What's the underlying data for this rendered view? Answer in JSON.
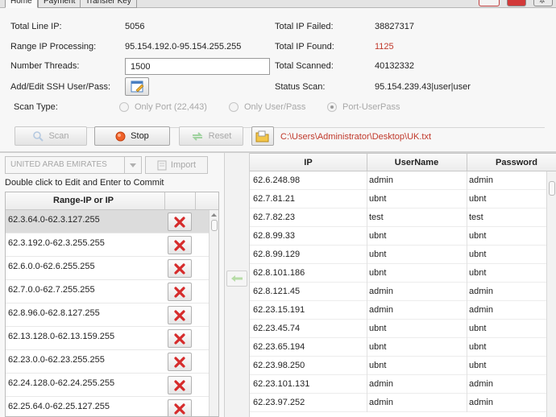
{
  "tabs": [
    "Home",
    "Payment",
    "Transfer Key"
  ],
  "stats": {
    "total_line_ip_label": "Total Line IP:",
    "total_line_ip": "5056",
    "range_ip_label": "Range IP Processing:",
    "range_ip": "95.154.192.0-95.154.255.255",
    "threads_label": "Number Threads:",
    "threads_value": "1500",
    "ssh_label": "Add/Edit SSH User/Pass:",
    "total_failed_label": "Total IP Failed:",
    "total_failed": "38827317",
    "total_found_label": "Total IP Found:",
    "total_found": "1125",
    "total_scanned_label": "Total Scanned:",
    "total_scanned": "40132332",
    "status_label": "Status Scan:",
    "status": "95.154.239.43|user|user"
  },
  "scan_type": {
    "label": "Scan Type:",
    "options": [
      "Only Port (22,443)",
      "Only User/Pass",
      "Port-UserPass"
    ],
    "selected": "Port-UserPass"
  },
  "toolbar": {
    "scan": "Scan",
    "stop": "Stop",
    "reset": "Reset",
    "path": "C:\\Users\\Administrator\\Desktop\\UK.txt"
  },
  "left": {
    "country": "UNITED ARAB EMIRATES",
    "import": "Import",
    "hint": "Double click to Edit and Enter to Commit",
    "column": "Range-IP or IP",
    "ranges": [
      "62.3.64.0-62.3.127.255",
      "62.3.192.0-62.3.255.255",
      "62.6.0.0-62.6.255.255",
      "62.7.0.0-62.7.255.255",
      "62.8.96.0-62.8.127.255",
      "62.13.128.0-62.13.159.255",
      "62.23.0.0-62.23.255.255",
      "62.24.128.0-62.24.255.255",
      "62.25.64.0-62.25.127.255"
    ]
  },
  "results": {
    "columns": [
      "IP",
      "UserName",
      "Password"
    ],
    "rows": [
      [
        "62.6.248.98",
        "admin",
        "admin"
      ],
      [
        "62.7.81.21",
        "ubnt",
        "ubnt"
      ],
      [
        "62.7.82.23",
        "test",
        "test"
      ],
      [
        "62.8.99.33",
        "ubnt",
        "ubnt"
      ],
      [
        "62.8.99.129",
        "ubnt",
        "ubnt"
      ],
      [
        "62.8.101.186",
        "ubnt",
        "ubnt"
      ],
      [
        "62.8.121.45",
        "admin",
        "admin"
      ],
      [
        "62.23.15.191",
        "admin",
        "admin"
      ],
      [
        "62.23.45.74",
        "ubnt",
        "ubnt"
      ],
      [
        "62.23.65.194",
        "ubnt",
        "ubnt"
      ],
      [
        "62.23.98.250",
        "ubnt",
        "ubnt"
      ],
      [
        "62.23.101.131",
        "admin",
        "admin"
      ],
      [
        "62.23.97.252",
        "admin",
        "admin"
      ]
    ]
  },
  "colors": {
    "accent_red": "#c0392b",
    "stop_orange": "#f0622a",
    "delete_red": "#d62b2b"
  },
  "icons": [
    "edit-icon",
    "search-icon",
    "stop-icon",
    "reset-icon",
    "folder-icon",
    "import-icon",
    "delete-icon",
    "arrow-left-icon"
  ]
}
